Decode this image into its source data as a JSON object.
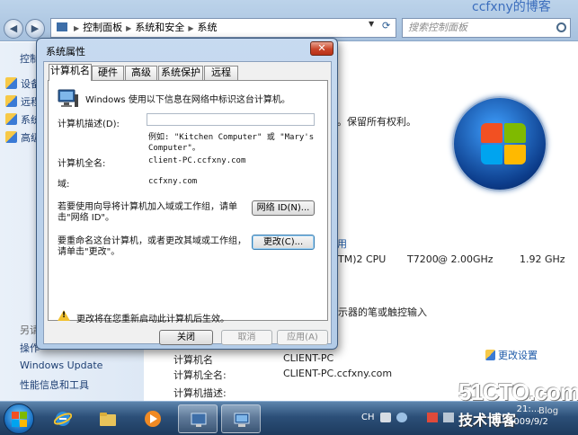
{
  "watermark": {
    "top": "ccfxny的博客",
    "bottom_site": "51CTO.com",
    "bottom_blog": "技术博客",
    "bottom_blog_en": "Blog"
  },
  "explorer": {
    "breadcrumb": [
      "控制面板",
      "系统和安全",
      "系统"
    ],
    "search_placeholder": "搜索控制面板"
  },
  "sidebar": {
    "home_label": "控制",
    "items": [
      {
        "label": "设备"
      },
      {
        "label": "远程"
      },
      {
        "label": "系统"
      },
      {
        "label": "高级"
      }
    ],
    "see_also": "另请",
    "action_center": "操作",
    "windows_update": "Windows Update",
    "perf_info": "性能信息和工具"
  },
  "system_info": {
    "copyright_tail": "。保留所有权利。",
    "rating_link": "用",
    "cpu_model": "TM)2 CPU",
    "cpu_t": "T7200",
    "cpu_freq1": "@ 2.00GHz",
    "cpu_freq2": "1.92 GHz",
    "pen_touch": "示器的笔或触控输入",
    "computer_name_label": "计算机名:",
    "full_name_label": "计算机全名:",
    "full_name_value": "CLIENT-PC.ccfxny.com",
    "description_label": "计算机描述:",
    "change_settings": "更改设置",
    "partial_label_top": "计算机名",
    "partial_value_top": "CLIENT-PC"
  },
  "dialog": {
    "title": "系统属性",
    "close_glyph": "✕",
    "tabs": [
      "计算机名",
      "硬件",
      "高级",
      "系统保护",
      "远程"
    ],
    "intro": "Windows 使用以下信息在网络中标识这台计算机。",
    "description_label": "计算机描述(D):",
    "description_value": "",
    "example_line1": "例如: \"Kitchen Computer\" 或 \"Mary's",
    "example_line2": "Computer\"。",
    "full_name_label": "计算机全名:",
    "full_name_value": "client-PC.ccfxny.com",
    "domain_label": "域:",
    "domain_value": "ccfxny.com",
    "network_id_text1": "若要使用向导将计算机加入域或工作组，请单",
    "network_id_text2": "击\"网络 ID\"。",
    "network_id_button": "网络 ID(N)...",
    "rename_text1": "要重命名这台计算机，或者更改其域或工作组，",
    "rename_text2": "请单击\"更改\"。",
    "change_button": "更改(C)...",
    "warning_text": "更改将在您重新启动此计算机后生效。",
    "ok_button": "关闭",
    "cancel_button": "取消",
    "apply_button": "应用(A)"
  },
  "taskbar": {
    "lang": "CH",
    "clock_time": "21:...",
    "clock_date": "2009/9/2"
  }
}
